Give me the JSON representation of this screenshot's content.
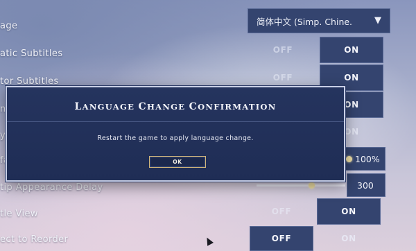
{
  "settings": {
    "rows": [
      {
        "label": "age"
      },
      {
        "label": "atic Subtitles",
        "off": "OFF",
        "on": "ON"
      },
      {
        "label": "tor Subtitles",
        "off": "OFF",
        "on": "ON"
      },
      {
        "label": "m",
        "on": "ON"
      },
      {
        "label": "y",
        "on": "ON"
      },
      {
        "label": "fa",
        "value": "100%"
      },
      {
        "label": "tip Appearance Delay",
        "value": "300"
      },
      {
        "label": "tle View",
        "off": "OFF",
        "on": "ON"
      },
      {
        "label": "ect to Reorder",
        "off": "OFF",
        "on": "ON"
      }
    ],
    "language": {
      "value": "简体中文 (Simp. Chine.",
      "arrow": "▼"
    },
    "sliders": {
      "opacity_value": 1.0,
      "tooltip_delay_value": 0.6
    }
  },
  "modal": {
    "title_first_letter_1": "L",
    "title_rest_1": "ANGUAGE",
    "title_first_letter_2": "C",
    "title_rest_2": "HANGE",
    "title_first_letter_3": "C",
    "title_rest_3": "ONFIRMATION",
    "message": "Restart the game to apply language change.",
    "ok_label": "OK"
  }
}
